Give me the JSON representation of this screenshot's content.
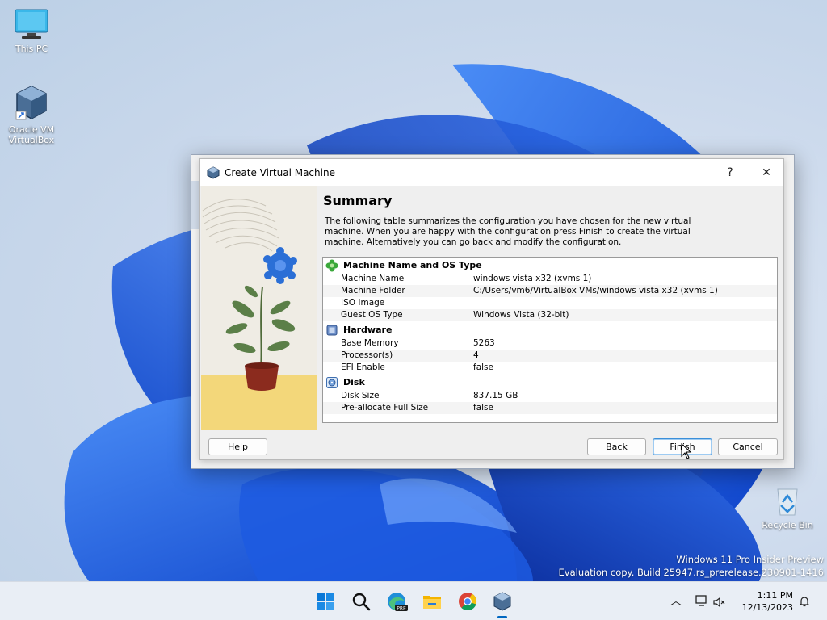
{
  "desktop": {
    "icons": [
      {
        "label": "This PC"
      },
      {
        "label": "Oracle VM VirtualBox"
      },
      {
        "label": "Recycle Bin"
      }
    ],
    "watermark": {
      "line1": "Windows 11 Pro Insider Preview",
      "line2": "Evaluation copy. Build 25947.rs_prerelease.230901-1416"
    }
  },
  "dialog": {
    "title": "Create Virtual Machine",
    "help_glyph": "?",
    "close_glyph": "✕",
    "heading": "Summary",
    "description": "The following table summarizes the configuration you have chosen for the new virtual machine. When you are happy with the configuration press Finish to create the virtual machine. Alternatively you can go back and modify the configuration.",
    "sections": [
      {
        "title": "Machine Name and OS Type",
        "icon": "os-type-icon",
        "rows": [
          {
            "key": "Machine Name",
            "value": "windows vista x32 (xvms 1)"
          },
          {
            "key": "Machine Folder",
            "value": "C:/Users/vm6/VirtualBox VMs/windows vista x32 (xvms 1)"
          },
          {
            "key": "ISO Image",
            "value": ""
          },
          {
            "key": "Guest OS Type",
            "value": "Windows Vista (32-bit)"
          }
        ]
      },
      {
        "title": "Hardware",
        "icon": "chip-icon",
        "rows": [
          {
            "key": "Base Memory",
            "value": "5263"
          },
          {
            "key": "Processor(s)",
            "value": "4"
          },
          {
            "key": "EFI Enable",
            "value": "false"
          }
        ]
      },
      {
        "title": "Disk",
        "icon": "disk-icon",
        "rows": [
          {
            "key": "Disk Size",
            "value": "837.15 GB"
          },
          {
            "key": "Pre-allocate Full Size",
            "value": "false"
          }
        ]
      }
    ],
    "buttons": {
      "help": "Help",
      "back": "Back",
      "finish": "Finish",
      "cancel": "Cancel"
    }
  },
  "taskbar": {
    "time": "1:11 PM",
    "date": "12/13/2023",
    "colors": {
      "accent": "#0067c0",
      "taskbar": "#e9eef5"
    }
  }
}
